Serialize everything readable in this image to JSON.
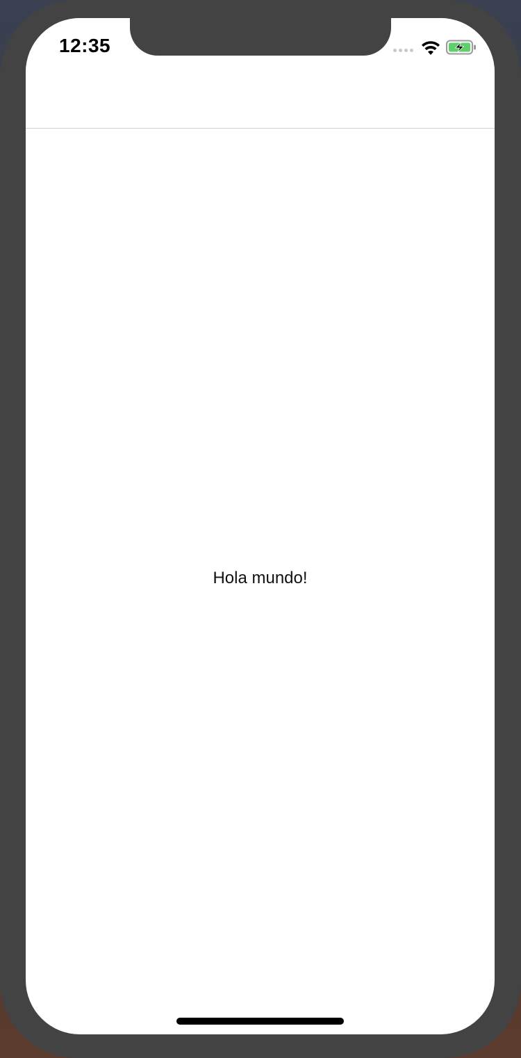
{
  "status_bar": {
    "time": "12:35",
    "signal_icon": "cellular-signal-icon",
    "wifi_icon": "wifi-icon",
    "battery_icon": "battery-charging-icon",
    "battery_color": "#5ecf6a"
  },
  "content": {
    "message": "Hola mundo!"
  },
  "colors": {
    "device_frame": "#434343",
    "screen_background": "#ffffff",
    "divider": "#cfcfcf"
  }
}
